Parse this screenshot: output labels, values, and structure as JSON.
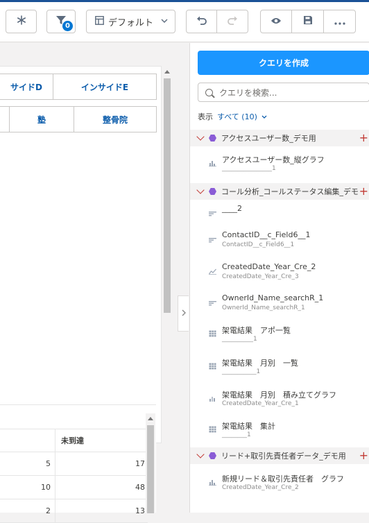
{
  "toolbar": {
    "filter_badge": "0",
    "layout_select": "デフォルト",
    "undo_icon": "undo-icon",
    "redo_icon": "redo-icon",
    "preview_icon": "eye-icon",
    "save_icon": "save-icon",
    "more_icon": "more-icon"
  },
  "canvas": {
    "header_cells_top": [
      "サイドD",
      "インサイドE"
    ],
    "header_cells_mid": [
      "",
      "塾",
      "整骨院"
    ],
    "table_header": [
      "",
      "未到達"
    ],
    "table_rows": [
      [
        "5",
        "17"
      ],
      [
        "10",
        "48"
      ],
      [
        "2",
        "13"
      ]
    ]
  },
  "panel": {
    "create_button": "クエリを作成",
    "search_placeholder": "クエリを検索...",
    "filter_label": "表示",
    "filter_value": "すべて (10)",
    "groups": [
      {
        "name": "アクセスユーザー数_デモ用",
        "items": [
          {
            "title": "アクセスユーザー数_縦グラフ",
            "sub": "________________1",
            "icon": "bar-chart-icon"
          }
        ]
      },
      {
        "name": "コール分析_コールステータス編集_デモ用",
        "items": [
          {
            "title": "____2",
            "sub": "",
            "icon": "filter-lines-icon"
          },
          {
            "title": "ContactID__c_Field6__1",
            "sub": "ContactID__c_Field6__1",
            "icon": "filter-lines-icon"
          },
          {
            "title": "CreatedDate_Year_Cre_2",
            "sub": "CreatedDate_Year_Cre_3",
            "icon": "line-chart-icon"
          },
          {
            "title": "OwnerId_Name_searchR_1",
            "sub": "OwnerId_Name_searchR_1",
            "icon": "filter-lines-icon"
          },
          {
            "title": "架電結果　アポ一覧",
            "sub": "__________1",
            "icon": "table-icon"
          },
          {
            "title": "架電結果　月別　一覧",
            "sub": "___________1",
            "icon": "table-icon"
          },
          {
            "title": "架電結果　月別　積み立てグラフ",
            "sub": "CreatedDate_Year_Cre_1",
            "icon": "stacked-chart-icon"
          },
          {
            "title": "架電結果　集計",
            "sub": "________1",
            "icon": "table-icon"
          }
        ]
      },
      {
        "name": "リード+取引先責任者データ_デモ用",
        "items": [
          {
            "title": "新規リード＆取引先責任者　グラフ",
            "sub": "CreatedDate_Year_Cre_2",
            "icon": "bar-chart-icon"
          }
        ]
      }
    ]
  }
}
